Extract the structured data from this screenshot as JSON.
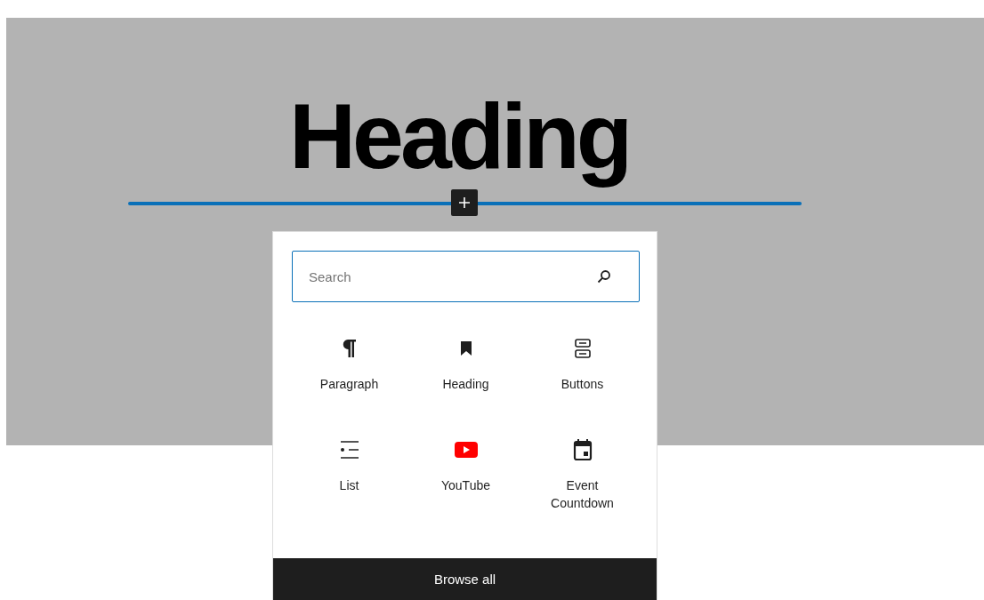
{
  "canvas": {
    "heading": "Heading"
  },
  "inserter": {
    "search": {
      "placeholder": "Search"
    },
    "blocks": [
      {
        "label": "Paragraph"
      },
      {
        "label": "Heading"
      },
      {
        "label": "Buttons"
      },
      {
        "label": "List"
      },
      {
        "label": "YouTube"
      },
      {
        "label": "Event Countdown"
      }
    ],
    "browse_all": "Browse all"
  }
}
